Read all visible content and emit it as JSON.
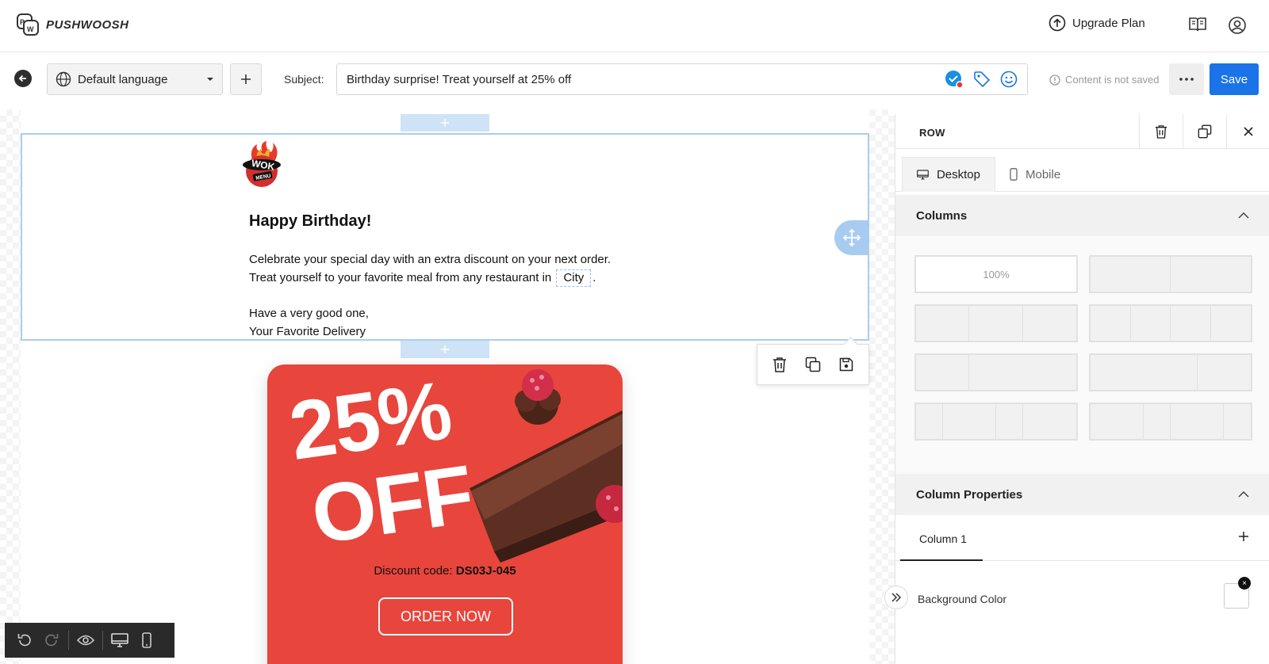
{
  "brand": {
    "logo_text": "PUSHWOOSH"
  },
  "header": {
    "upgrade_label": "Upgrade Plan"
  },
  "toolbar": {
    "language": "Default language",
    "subject_label": "Subject:",
    "subject_value": "Birthday surprise! Treat yourself at 25% off",
    "status": "Content is not saved",
    "save_label": "Save"
  },
  "email": {
    "logo_top": "WOK",
    "logo_bottom": "MENU",
    "title": "Happy Birthday!",
    "line1": "Celebrate your special day with an extra discount on your next order.",
    "line2_prefix": "Treat yourself to your favorite meal from any restaurant in",
    "city_tag": "City",
    "line2_suffix": ".",
    "sign1": "Have a very good one,",
    "sign2": "Your Favorite Delivery",
    "promo_pct": "25%",
    "promo_off": "OFF",
    "discount_label": "Discount code:",
    "discount_code": "DS03J-045",
    "order_label": "ORDER NOW"
  },
  "panel": {
    "title": "ROW",
    "tab_desktop": "Desktop",
    "tab_mobile": "Mobile",
    "columns_heading": "Columns",
    "layout_full_label": "100%",
    "column_props_heading": "Column Properties",
    "column_tab": "Column 1",
    "bg_color_label": "Background Color"
  },
  "colors": {
    "accent": "#1a73e8",
    "promo": "#e8453c",
    "selection": "#a9cdf0"
  }
}
